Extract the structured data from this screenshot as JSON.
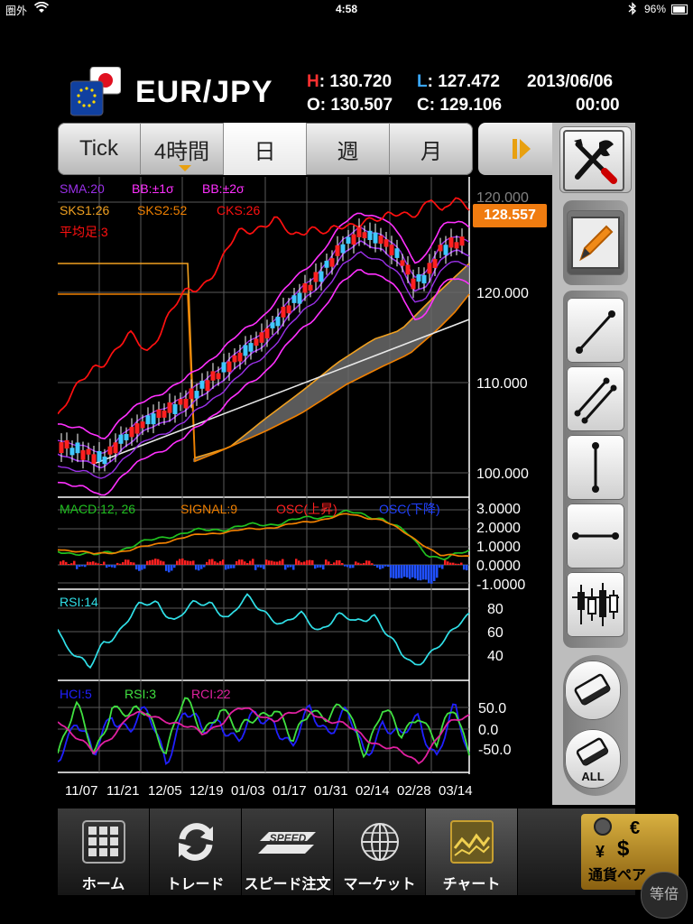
{
  "status_bar": {
    "carrier": "圏外",
    "time": "4:58",
    "battery": "96%"
  },
  "header": {
    "pair": "EUR/JPY",
    "high_label": "H",
    "high": ": 130.720",
    "low_label": "L",
    "low": ": 127.472",
    "open_label": "O",
    "open": ": 130.507",
    "close_label": "C",
    "close": ": 129.106",
    "date": "2013/06/06",
    "time": "00:00"
  },
  "period_tabs": [
    "Tick",
    "4時間",
    "日",
    "週",
    "月"
  ],
  "active_period": "日",
  "current_price": "128.557",
  "colors": {
    "up_candle": "#ff2020",
    "down_candle": "#40c8ff",
    "sma": "#9a30e8",
    "bb": "#ff30ff",
    "sks1": "#f0a020",
    "sks2": "#f08000",
    "cks": "#ff1010",
    "macd": "#20c020",
    "signal": "#f08000",
    "rsi": "#30e0e8",
    "hci_blue": "#2020ff",
    "hci_green": "#40e040",
    "hci_magenta": "#e020a0",
    "price_tag": "#f07c10"
  },
  "main_legend": [
    "SMA:20",
    "BB:±1σ",
    "BB:±2σ",
    "SKS1:26",
    "SKS2:52",
    "CKS:26",
    "平均足:3"
  ],
  "macd_legend": [
    "MACD:12, 26",
    "SIGNAL:9",
    "OSC(上昇)",
    "OSC(下降)"
  ],
  "rsi_legend": [
    "RSI:14"
  ],
  "hci_legend": [
    "HCI:5",
    "RSI:3",
    "RCI:22"
  ],
  "main_axis": [
    "120.000",
    "120.000",
    "110.000",
    "100.000"
  ],
  "macd_axis": [
    "3.0000",
    "2.0000",
    "1.0000",
    "0.0000",
    "-1.0000"
  ],
  "rsi_axis": [
    "80",
    "60",
    "40"
  ],
  "hci_axis": [
    "50.0",
    "0.0",
    "-50.0"
  ],
  "x_labels": [
    "11/07",
    "11/21",
    "12/05",
    "12/19",
    "01/03",
    "01/17",
    "01/31",
    "02/14",
    "02/28",
    "03/14"
  ],
  "toolbar": {
    "all_label": "ALL"
  },
  "tabbar": [
    {
      "label": "ホーム",
      "icon": "grid-icon"
    },
    {
      "label": "トレード",
      "icon": "refresh-icon"
    },
    {
      "label": "スピード注文",
      "icon": "speed-icon",
      "badge": "SPEED"
    },
    {
      "label": "マーケット",
      "icon": "globe-icon"
    },
    {
      "label": "チャート",
      "icon": "chart-icon"
    },
    {
      "label": "通貨ペア",
      "icon": "currency-icon"
    }
  ],
  "active_tab": "チャート",
  "zoom_label": "等倍"
}
